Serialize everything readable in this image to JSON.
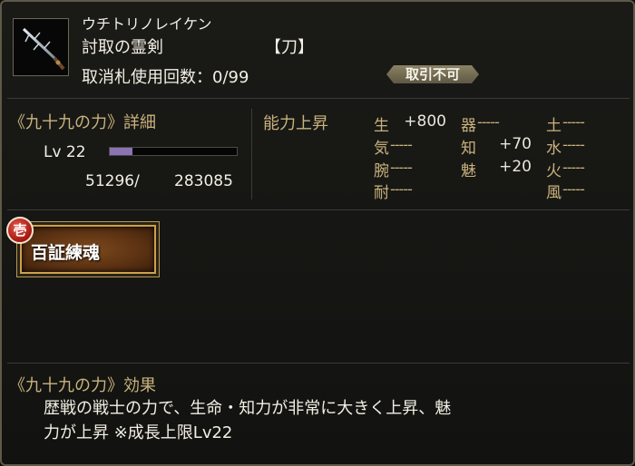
{
  "item": {
    "reading": "ウチトリノレイケン",
    "name": "討取の霊剣",
    "type": "【刀】",
    "cancel_label": "取消札使用回数：0/99",
    "tradable_badge": "取引不可"
  },
  "detail": {
    "heading": "《九十九の力》詳細",
    "level_label": "Lv 22",
    "level_progress": 0.18,
    "exp_current": "51296/",
    "exp_max": "283085"
  },
  "ability": {
    "heading": "能力上昇",
    "stats": [
      {
        "name": "生",
        "value": "+800"
      },
      {
        "name": "気",
        "value": "-----"
      },
      {
        "name": "腕",
        "value": "-----"
      },
      {
        "name": "耐",
        "value": "-----"
      },
      {
        "name": "器",
        "value": "-----"
      },
      {
        "name": "知",
        "value": "+70"
      },
      {
        "name": "魅",
        "value": "+20"
      },
      {
        "name": "土",
        "value": "-----"
      },
      {
        "name": "水",
        "value": "-----"
      },
      {
        "name": "火",
        "value": "-----"
      },
      {
        "name": "風",
        "value": "-----"
      }
    ]
  },
  "skill": {
    "badge": "壱",
    "label": "百証練魂"
  },
  "effect": {
    "heading": "《九十九の力》効果",
    "line1": "歴戦の戦士の力で、生命・知力が非常に大きく上昇、魅",
    "line2": "力が上昇 ※成長上限Lv22"
  },
  "colors": {
    "label_gold": "#c9b27d",
    "exp_bar": "#8b73b4",
    "badge_red": "#c0281c"
  }
}
